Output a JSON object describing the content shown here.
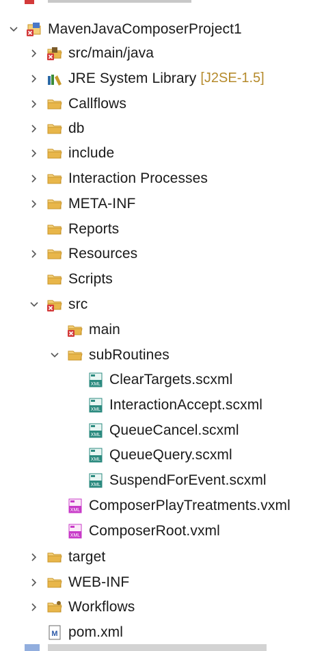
{
  "tree": {
    "project": {
      "label": "MavenJavaComposerProject1",
      "icon": "project-icon"
    },
    "src_main_java": {
      "label": "src/main/java",
      "icon": "source-folder-icon"
    },
    "jre": {
      "label": "JRE System Library",
      "decoration": "[J2SE-1.5]",
      "icon": "library-icon"
    },
    "callflows": {
      "label": "Callflows",
      "icon": "folder-icon"
    },
    "db": {
      "label": "db",
      "icon": "folder-icon"
    },
    "include": {
      "label": "include",
      "icon": "folder-icon"
    },
    "interaction_processes": {
      "label": "Interaction Processes",
      "icon": "folder-icon"
    },
    "meta_inf": {
      "label": "META-INF",
      "icon": "folder-icon"
    },
    "reports": {
      "label": "Reports",
      "icon": "folder-icon"
    },
    "resources": {
      "label": "Resources",
      "icon": "folder-icon"
    },
    "scripts": {
      "label": "Scripts",
      "icon": "folder-icon"
    },
    "src": {
      "label": "src",
      "icon": "folder-error-icon"
    },
    "main": {
      "label": "main",
      "icon": "folder-error-icon"
    },
    "subroutines": {
      "label": "subRoutines",
      "icon": "folder-icon"
    },
    "files": [
      {
        "label": "ClearTargets.scxml",
        "icon": "scxml-file-icon"
      },
      {
        "label": "InteractionAccept.scxml",
        "icon": "scxml-file-icon"
      },
      {
        "label": "QueueCancel.scxml",
        "icon": "scxml-file-icon"
      },
      {
        "label": "QueueQuery.scxml",
        "icon": "scxml-file-icon"
      },
      {
        "label": "SuspendForEvent.scxml",
        "icon": "scxml-file-icon"
      }
    ],
    "composer_play": {
      "label": "ComposerPlayTreatments.vxml",
      "icon": "vxml-file-icon"
    },
    "composer_root": {
      "label": "ComposerRoot.vxml",
      "icon": "vxml-file-icon"
    },
    "target": {
      "label": "target",
      "icon": "folder-icon"
    },
    "web_inf": {
      "label": "WEB-INF",
      "icon": "folder-icon"
    },
    "workflows": {
      "label": "Workflows",
      "icon": "workflow-folder-icon"
    },
    "pom": {
      "label": "pom.xml",
      "icon": "maven-file-icon"
    }
  },
  "colors": {
    "folder": "#e8b64a",
    "decoration": "#b58a2b",
    "error": "#d33a3a",
    "scxml": "#2b8a7f",
    "vxml": "#c83ac8"
  }
}
